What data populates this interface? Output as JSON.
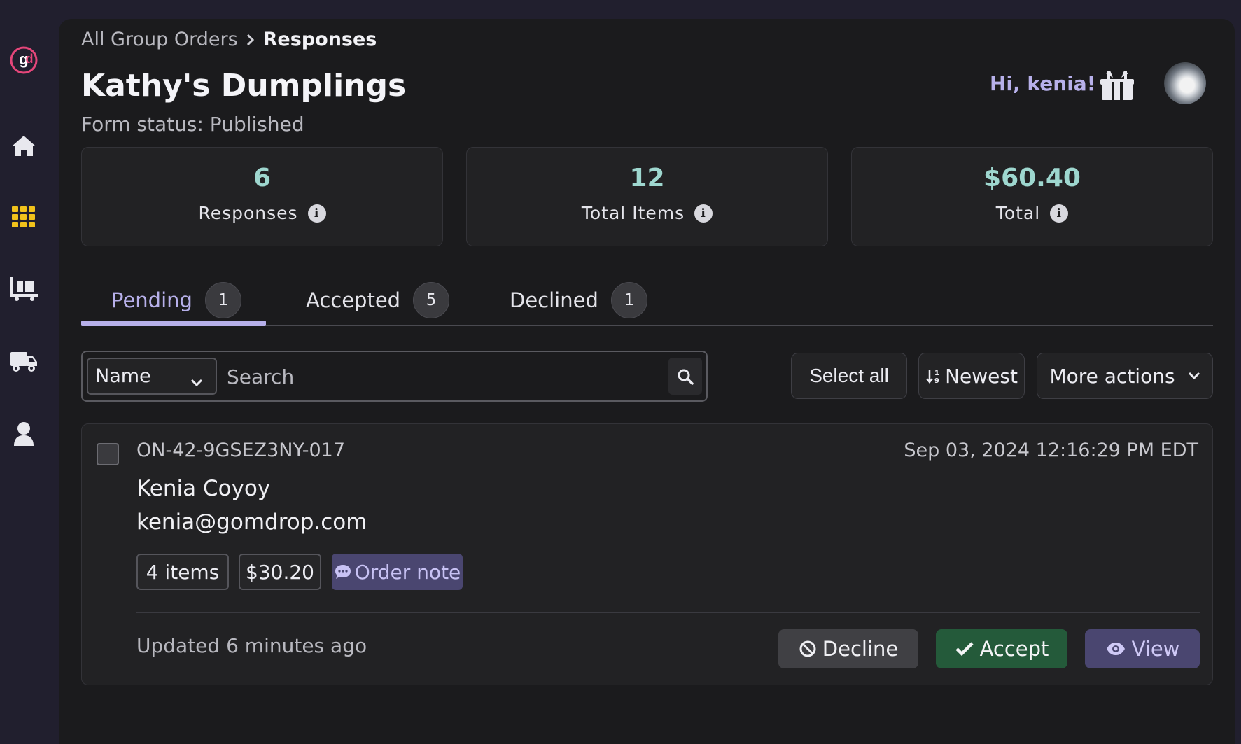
{
  "sidebar": {
    "logo_text": "gd",
    "items": [
      {
        "icon": "home-icon"
      },
      {
        "icon": "grid-icon"
      },
      {
        "icon": "pallet-icon"
      },
      {
        "icon": "truck-icon"
      },
      {
        "icon": "user-icon"
      }
    ]
  },
  "breadcrumb": {
    "parent": "All Group Orders",
    "current": "Responses"
  },
  "page": {
    "title": "Kathy's Dumplings",
    "status": "Form status: Published"
  },
  "header": {
    "greeting": "Hi, kenia!"
  },
  "stats": [
    {
      "value": "6",
      "label": "Responses"
    },
    {
      "value": "12",
      "label": "Total Items"
    },
    {
      "value": "$60.40",
      "label": "Total"
    }
  ],
  "tabs": [
    {
      "label": "Pending",
      "count": "1"
    },
    {
      "label": "Accepted",
      "count": "5"
    },
    {
      "label": "Declined",
      "count": "1"
    }
  ],
  "search": {
    "field": "Name",
    "placeholder": "Search"
  },
  "toolbar": {
    "select_all": "Select all",
    "sort": "Newest",
    "more": "More actions"
  },
  "response": {
    "order_id": "ON-42-9GSEZ3NY-017",
    "date": "Sep 03, 2024 12:16:29 PM EDT",
    "name": "Kenia Coyoy",
    "email": "kenia@gomdrop.com",
    "items": "4 items",
    "amount": "$30.20",
    "note": "Order note",
    "updated": "Updated 6 minutes ago",
    "decline": "Decline",
    "accept": "Accept",
    "view": "View"
  },
  "colors": {
    "accent": "#b7b0ea",
    "stat_value": "#9ed7cf",
    "grid_icon": "#f1c21b",
    "accept": "#245a3a",
    "logo_pink": "#e5467a"
  }
}
